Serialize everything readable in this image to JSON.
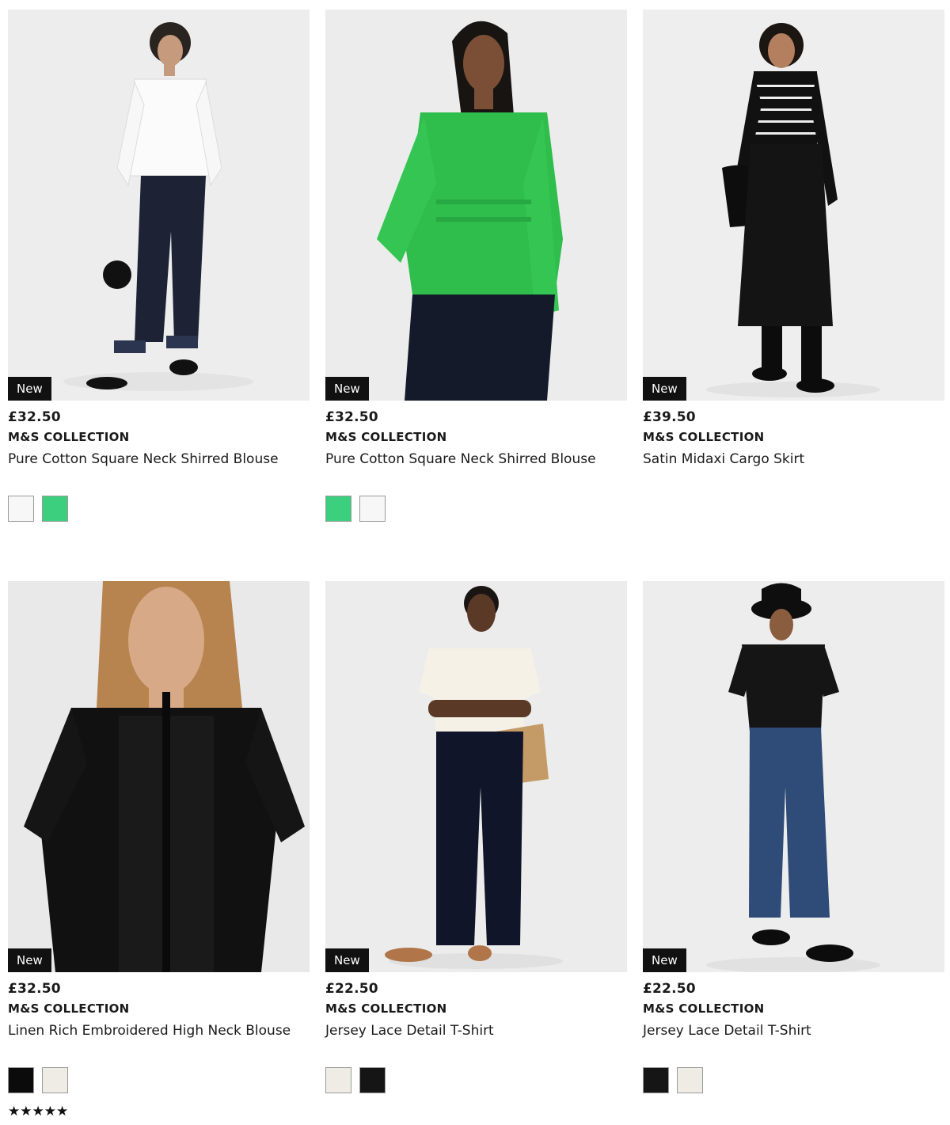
{
  "products": [
    {
      "badge": "New",
      "price": "£32.50",
      "brand": "M&S COLLECTION",
      "name": "Pure Cotton Square Neck Shirred Blouse",
      "image": "model-white-blouse-photo",
      "swatches": [
        {
          "color": "#f7f7f7",
          "label": "white"
        },
        {
          "color": "#3ccf7e",
          "label": "green"
        }
      ]
    },
    {
      "badge": "New",
      "price": "£32.50",
      "brand": "M&S COLLECTION",
      "name": "Pure Cotton Square Neck Shirred Blouse",
      "image": "model-green-blouse-photo",
      "swatches": [
        {
          "color": "#3ccf7e",
          "label": "green"
        },
        {
          "color": "#f7f7f7",
          "label": "white"
        }
      ]
    },
    {
      "badge": "New",
      "price": "£39.50",
      "brand": "M&S COLLECTION",
      "name": "Satin Midaxi Cargo Skirt",
      "image": "model-black-satin-skirt-photo",
      "swatches": []
    },
    {
      "badge": "New",
      "price": "£32.50",
      "brand": "M&S COLLECTION",
      "name": "Linen Rich Embroidered High Neck Blouse",
      "image": "model-black-linen-blouse-photo",
      "swatches": [
        {
          "color": "#0b0b0b",
          "label": "black"
        },
        {
          "color": "#efece6",
          "label": "ivory"
        }
      ],
      "rating": "★★★★★"
    },
    {
      "badge": "New",
      "price": "£22.50",
      "brand": "M&S COLLECTION",
      "name": "Jersey Lace Detail T-Shirt",
      "image": "model-ivory-tshirt-photo",
      "swatches": [
        {
          "color": "#efece6",
          "label": "ivory"
        },
        {
          "color": "#151515",
          "label": "black"
        }
      ]
    },
    {
      "badge": "New",
      "price": "£22.50",
      "brand": "M&S COLLECTION",
      "name": "Jersey Lace Detail T-Shirt",
      "image": "model-black-tshirt-photo",
      "swatches": [
        {
          "color": "#151515",
          "label": "black"
        },
        {
          "color": "#efece6",
          "label": "ivory"
        }
      ]
    }
  ],
  "colors": {
    "badge_bg": "#111111",
    "image_bg": "#ececec",
    "swatch_border": "#9a9a9a"
  }
}
